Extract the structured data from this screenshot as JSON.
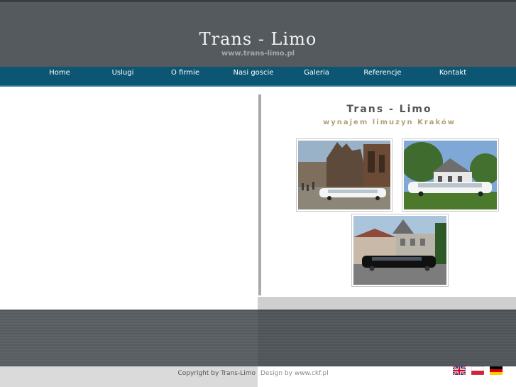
{
  "header": {
    "title": "Trans - Limo",
    "url": "www.trans-limo.pl"
  },
  "nav": [
    {
      "label": "Home"
    },
    {
      "label": "Uslugi"
    },
    {
      "label": "O firmie"
    },
    {
      "label": "Nasi goscie"
    },
    {
      "label": "Galeria"
    },
    {
      "label": "Referencje"
    },
    {
      "label": "Kontakt"
    }
  ],
  "content": {
    "title": "Trans - Limo",
    "subtitle": "wynajem limuzyn Kraków"
  },
  "footer": {
    "copyright": "Copyright by Trans-Limo",
    "design": "Design by www.ckf.pl"
  },
  "languages": [
    {
      "code": "en",
      "icon": "uk-flag-icon"
    },
    {
      "code": "pl",
      "icon": "pl-flag-icon"
    },
    {
      "code": "de",
      "icon": "de-flag-icon"
    }
  ],
  "colors": {
    "header": "#555a5e",
    "nav": "#0c5673",
    "subtitle": "#b1a074"
  }
}
